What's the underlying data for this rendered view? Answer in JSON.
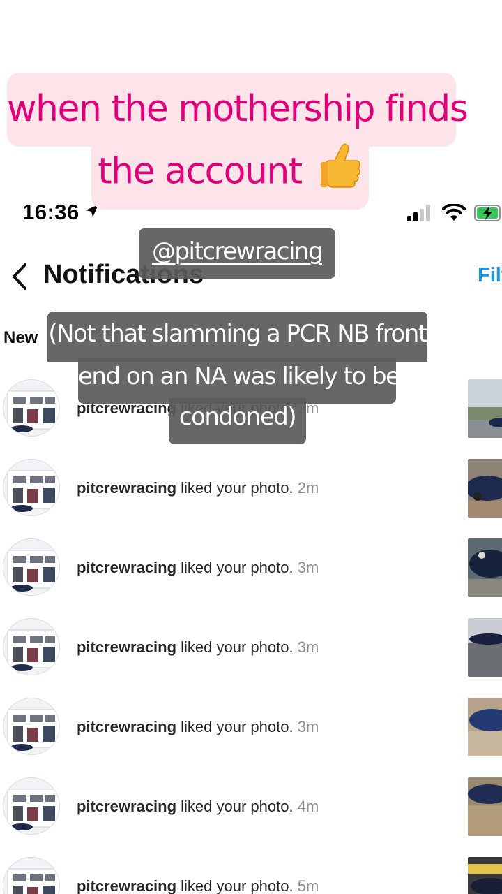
{
  "story": {
    "caption_line1": "when the mothership finds",
    "caption_line2": "the account",
    "caption_emoji": "thumbs-up",
    "mention": "@pitcrewracing",
    "note_line1": "(Not that slamming a PCR NB front",
    "note_line2": "end on an NA was likely to be",
    "note_line3": "condoned)",
    "caption_color": "#e0007a",
    "caption_bg": "#fde4e8"
  },
  "status_bar": {
    "time": "16:36",
    "icons": [
      "location-arrow-icon",
      "cellular-signal-icon",
      "wifi-icon",
      "battery-charging-icon"
    ]
  },
  "header": {
    "title": "Notifications",
    "filter_label": "Filt",
    "accent": "#1a93e8"
  },
  "section_label": "New",
  "notifications": [
    {
      "user": "pitcrewracing",
      "action": " liked your photo.",
      "time": " 2m",
      "thumb": "thumb-a"
    },
    {
      "user": "pitcrewracing",
      "action": " liked your photo.",
      "time": " 2m",
      "thumb": "thumb-b"
    },
    {
      "user": "pitcrewracing",
      "action": " liked your photo.",
      "time": " 3m",
      "thumb": "thumb-c"
    },
    {
      "user": "pitcrewracing",
      "action": " liked your photo.",
      "time": " 3m",
      "thumb": "thumb-d"
    },
    {
      "user": "pitcrewracing",
      "action": " liked your photo.",
      "time": " 3m",
      "thumb": "thumb-e"
    },
    {
      "user": "pitcrewracing",
      "action": " liked your photo.",
      "time": " 4m",
      "thumb": "thumb-f"
    },
    {
      "user": "pitcrewracing",
      "action": " liked your photo.",
      "time": " 5m",
      "thumb": "thumb-g"
    }
  ]
}
